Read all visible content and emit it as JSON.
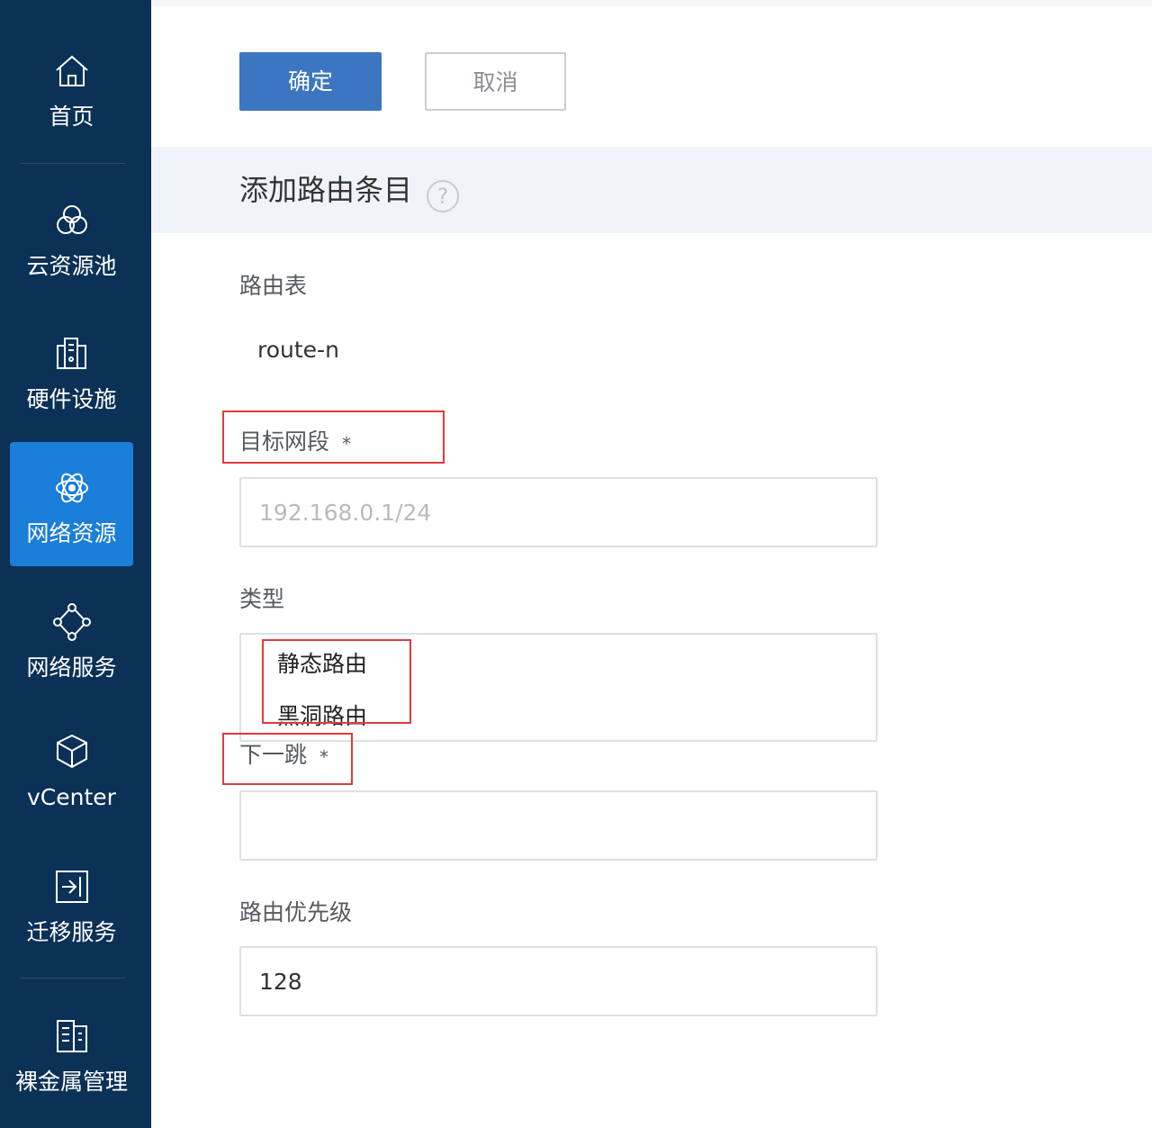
{
  "sidebar": {
    "items": [
      {
        "label": "首页",
        "icon": "home-icon"
      },
      {
        "label": "云资源池",
        "icon": "cloud-pool-icon"
      },
      {
        "label": "硬件设施",
        "icon": "hardware-icon"
      },
      {
        "label": "网络资源",
        "icon": "network-resource-icon",
        "active": true
      },
      {
        "label": "网络服务",
        "icon": "network-service-icon"
      },
      {
        "label": "vCenter",
        "icon": "cube-icon"
      },
      {
        "label": "迁移服务",
        "icon": "migrate-icon"
      },
      {
        "label": "裸金属管理",
        "icon": "bare-metal-icon"
      }
    ]
  },
  "toolbar": {
    "confirm_label": "确定",
    "cancel_label": "取消"
  },
  "section": {
    "title": "添加路由条目",
    "help": "?"
  },
  "form": {
    "route_table": {
      "label": "路由表",
      "value": "route-n"
    },
    "target_segment": {
      "label": "目标网段",
      "required_mark": "*",
      "placeholder": "192.168.0.1/24"
    },
    "type": {
      "label": "类型",
      "options": [
        "静态路由",
        "黑洞路由"
      ]
    },
    "next_hop": {
      "label": "下一跳",
      "required_mark": "*",
      "value": ""
    },
    "priority": {
      "label": "路由优先级",
      "value": "128"
    }
  },
  "colors": {
    "sidebar_bg": "#0b3157",
    "sidebar_active": "#1b7ed9",
    "primary": "#3d76c0",
    "highlight_red": "#e13b3b"
  }
}
